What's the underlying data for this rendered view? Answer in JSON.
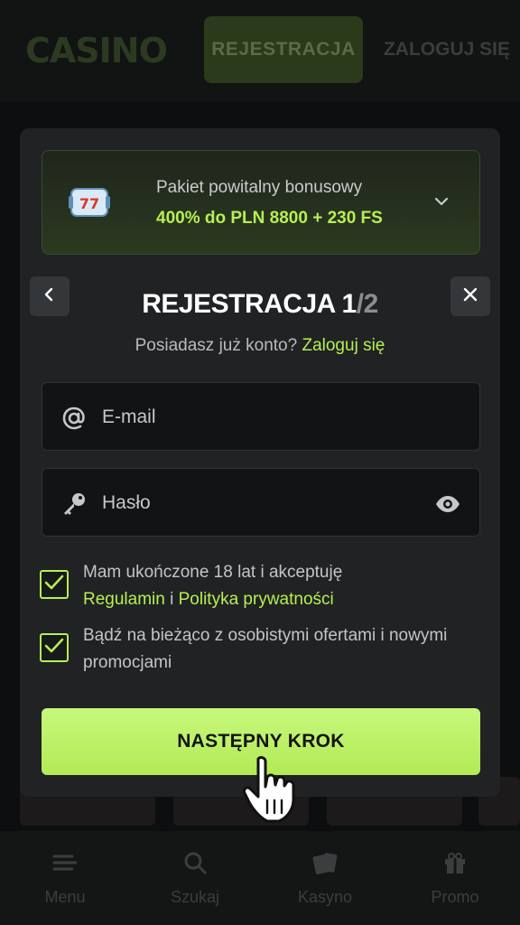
{
  "header": {
    "logo_text": "CASINO",
    "register_label": "REJESTRACJA",
    "login_label": "ZALOGUJ SIĘ"
  },
  "bottom_nav": {
    "items": [
      {
        "label": "Menu",
        "icon": "menu-icon"
      },
      {
        "label": "Szukaj",
        "icon": "search-icon"
      },
      {
        "label": "Kasyno",
        "icon": "cards-icon"
      },
      {
        "label": "Promo",
        "icon": "gift-icon"
      }
    ]
  },
  "modal": {
    "bonus": {
      "title": "Pakiet powitalny bonusowy",
      "value": "400% do PLN 8800 + 230 FS",
      "icon": "slot-reel-icon"
    },
    "title": "REJESTRACJA",
    "step_current": "1",
    "step_separator": "/",
    "step_total": "2",
    "subtitle_text": "Posiadasz już konto?",
    "subtitle_link": "Zaloguj się",
    "email": {
      "placeholder": "E-mail",
      "value": "",
      "icon": "at-icon"
    },
    "password": {
      "placeholder": "Hasło",
      "value": "",
      "icon": "key-icon",
      "toggle_icon": "eye-icon"
    },
    "consent1": {
      "text": "Mam ukończone 18 lat i akceptuję",
      "link1": "Regulamin",
      "separator": "i",
      "link2": "Polityka prywatności",
      "checked": true
    },
    "consent2": {
      "text": "Bądź na bieżąco z osobistymi ofertami i nowymi promocjami",
      "checked": true
    },
    "next_label": "NASTĘPNY KROK"
  },
  "colors": {
    "accent": "#b6ef52",
    "modal_bg": "#202223",
    "input_bg": "#121314"
  }
}
